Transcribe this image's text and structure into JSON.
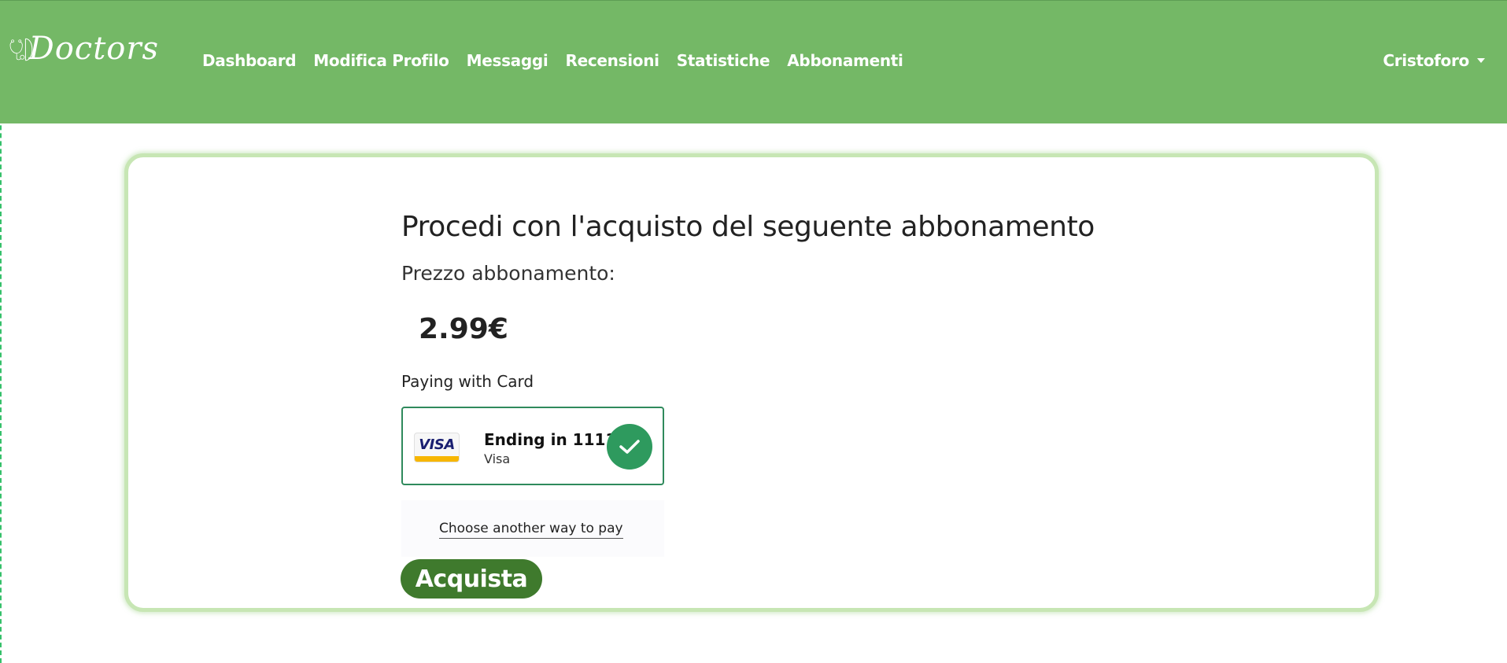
{
  "brand": {
    "name": "Doctors",
    "logo_icon": "stethoscope-logo-icon"
  },
  "nav": {
    "links": [
      {
        "label": "Dashboard"
      },
      {
        "label": "Modifica Profilo"
      },
      {
        "label": "Messaggi"
      },
      {
        "label": "Recensioni"
      },
      {
        "label": "Statistiche"
      },
      {
        "label": "Abbonamenti"
      }
    ],
    "user": {
      "name": "Cristoforo",
      "icon": "chevron-down-icon"
    }
  },
  "checkout": {
    "title": "Procedi con l'acquisto del seguente abbonamento",
    "price_label": "Prezzo abbonamento:",
    "price_value": "2.99€",
    "paying_with": "Paying with Card",
    "card": {
      "title": "Ending in 1111",
      "brand": "Visa",
      "logo_text": "VISA",
      "selected": true,
      "selected_icon": "checkmark-icon"
    },
    "other_method_label": "Choose another way to pay",
    "submit_label": "Acquista"
  },
  "colors": {
    "navbar": "#74b866",
    "card_border": "#c7e6b4",
    "selected_border": "#2f8a5c",
    "check_badge": "#2e9a5e",
    "buy_button": "#3f7a2d"
  }
}
